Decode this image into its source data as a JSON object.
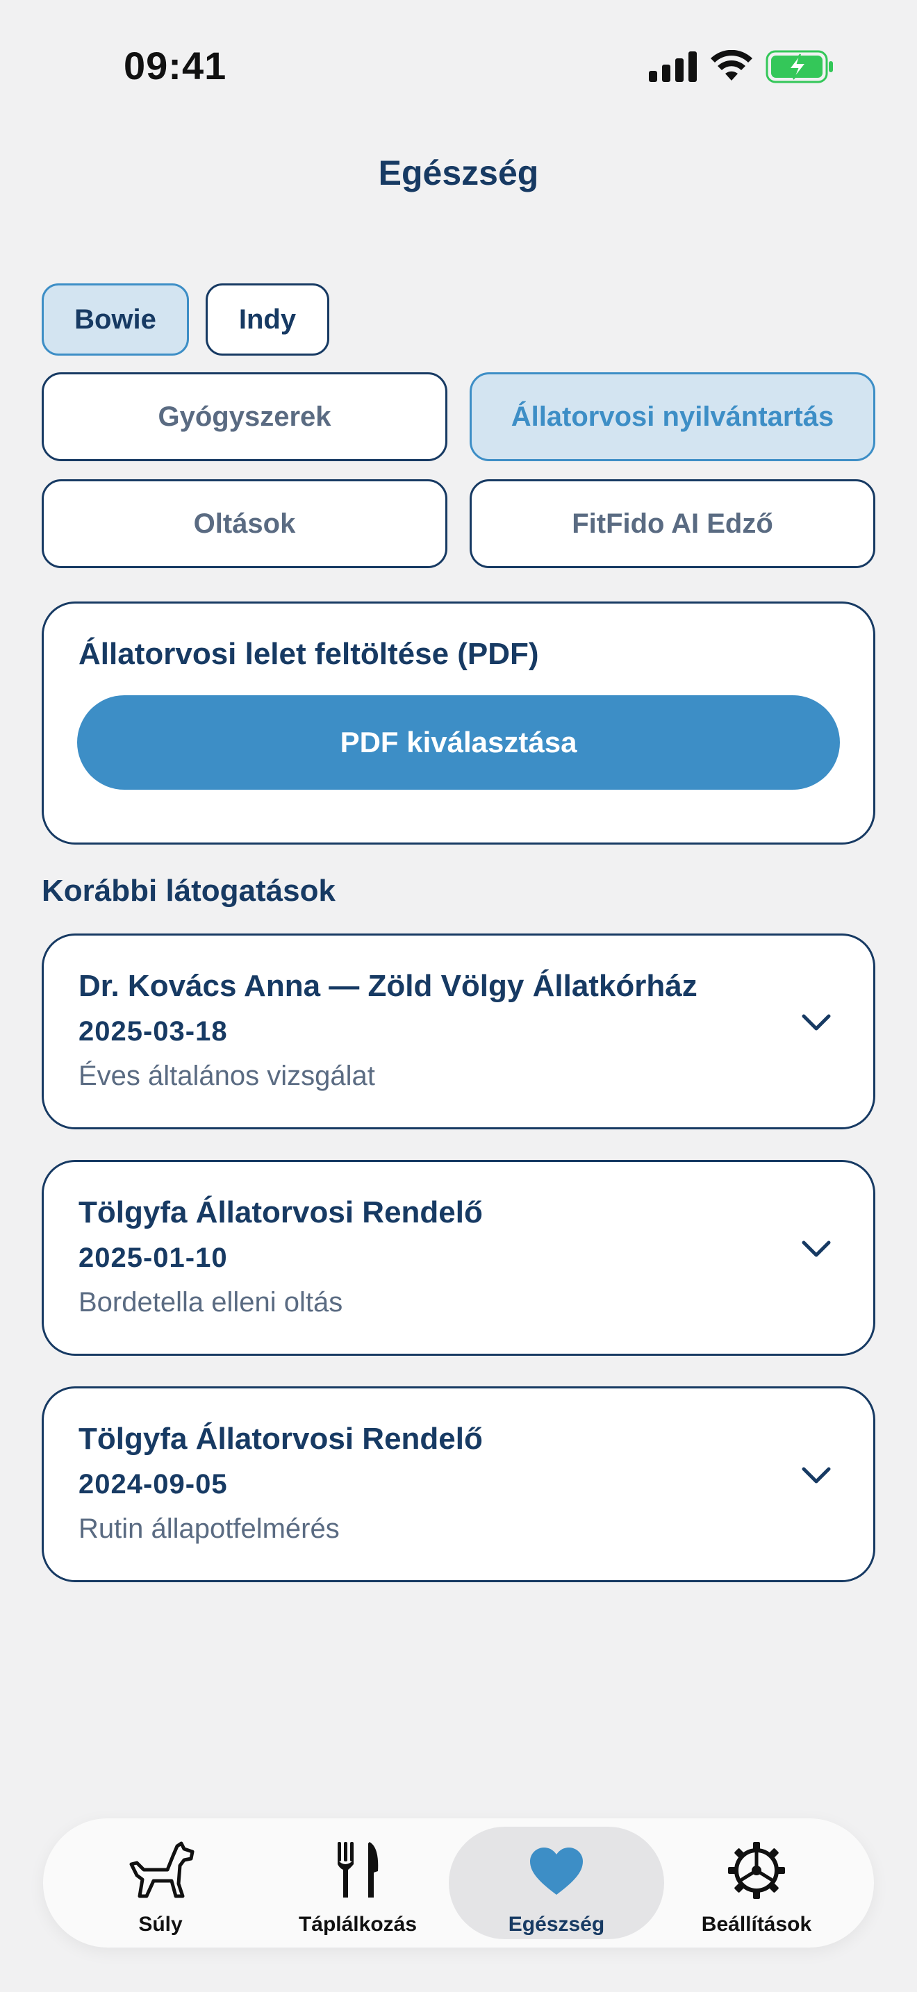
{
  "status_bar": {
    "time": "09:41"
  },
  "header": {
    "title": "Egészség"
  },
  "pets": [
    {
      "name": "Bowie",
      "selected": true
    },
    {
      "name": "Indy",
      "selected": false
    }
  ],
  "segments": [
    {
      "label": "Gyógyszerek",
      "selected": false
    },
    {
      "label": "Állatorvosi nyilvántartás",
      "selected": true
    },
    {
      "label": "Oltások",
      "selected": false
    },
    {
      "label": "FitFido AI Edző",
      "selected": false
    }
  ],
  "upload": {
    "title": "Állatorvosi lelet feltöltése (PDF)",
    "button_label": "PDF kiválasztása"
  },
  "visits": {
    "section_title": "Korábbi látogatások",
    "items": [
      {
        "title": "Dr. Kovács Anna — Zöld Völgy Állatkórház",
        "date": "2025-03-18",
        "description": "Éves általános vizsgálat"
      },
      {
        "title": "Tölgyfa Állatorvosi Rendelő",
        "date": "2025-01-10",
        "description": "Bordetella elleni oltás"
      },
      {
        "title": "Tölgyfa Állatorvosi Rendelő",
        "date": "2024-09-05",
        "description": "Rutin állapotfelmérés"
      }
    ]
  },
  "tabbar": {
    "items": [
      {
        "label": "Súly",
        "icon": "dog-icon",
        "active": false
      },
      {
        "label": "Táplálkozás",
        "icon": "fork-knife-icon",
        "active": false
      },
      {
        "label": "Egészség",
        "icon": "heart-icon",
        "active": true
      },
      {
        "label": "Beállítások",
        "icon": "gear-icon",
        "active": false
      }
    ]
  },
  "colors": {
    "accent": "#3d8ec6",
    "navy": "#173a63",
    "muted": "#5a6b82",
    "background": "#f1f1f2",
    "selected_fill": "#d3e4f1",
    "battery": "#34c759"
  }
}
